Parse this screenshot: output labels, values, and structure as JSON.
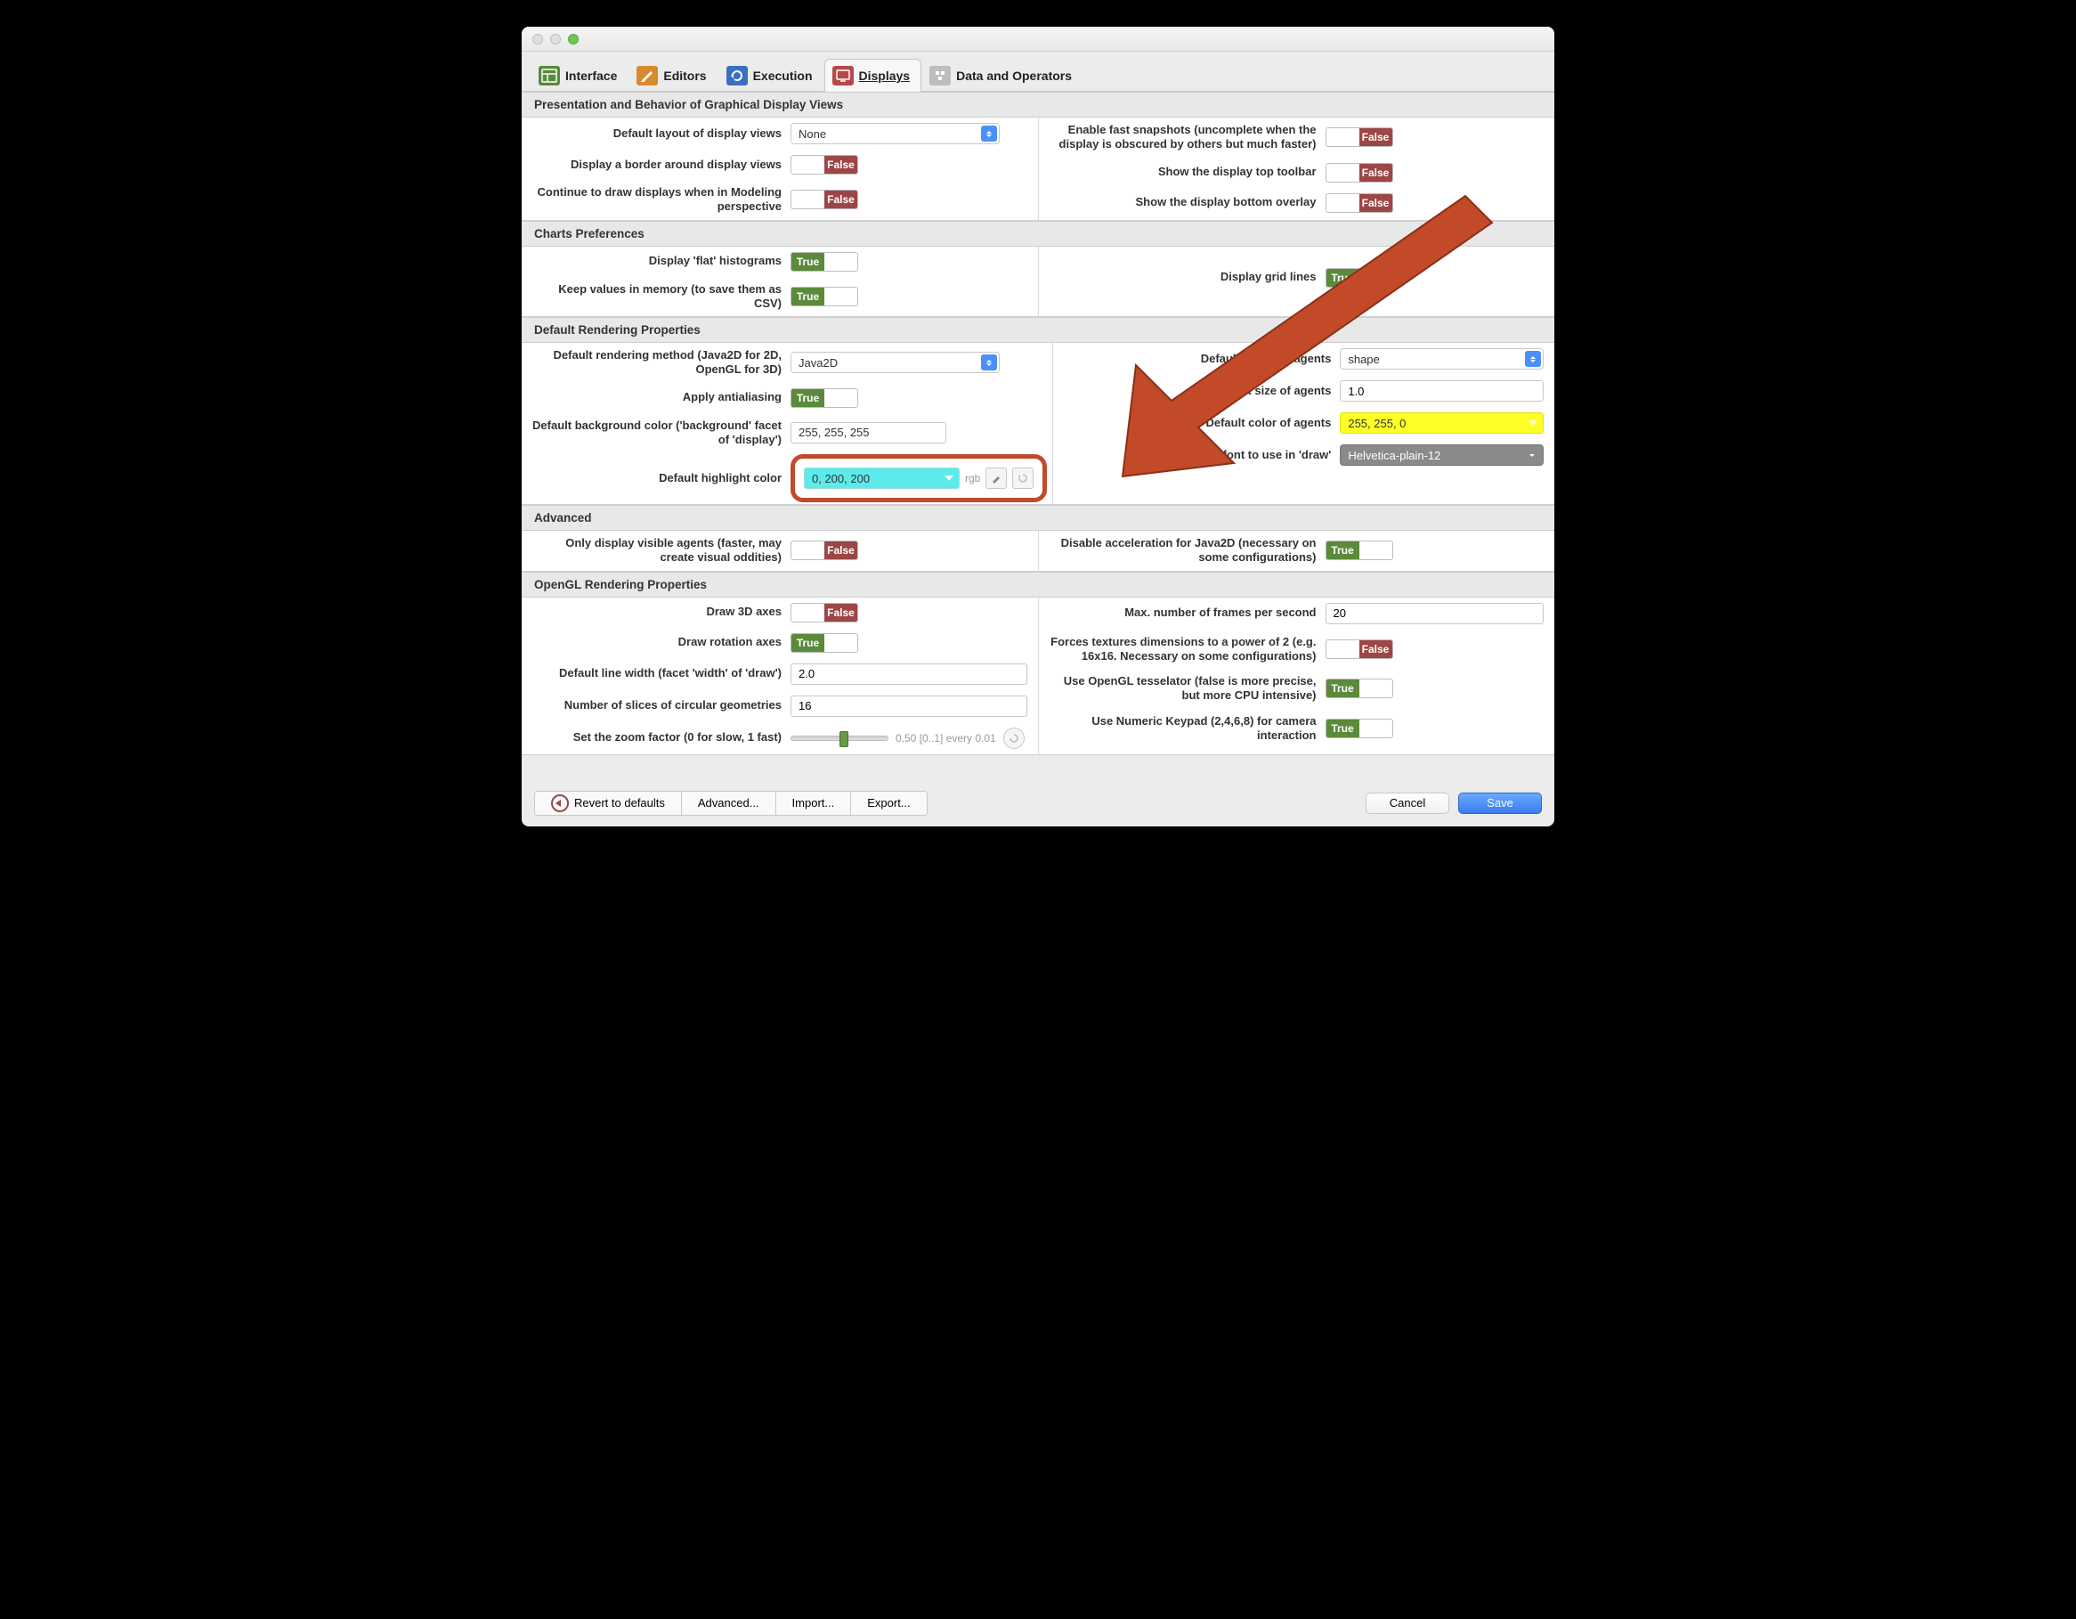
{
  "traffic_colors": {
    "close": "#e0e0e0",
    "min": "#e0e0e0",
    "max": "#6bc950"
  },
  "tabs": [
    {
      "label": "Interface",
      "icon_bg": "#5a8a3a"
    },
    {
      "label": "Editors",
      "icon_bg": "#d88a2e"
    },
    {
      "label": "Execution",
      "icon_bg": "#3a6fbf"
    },
    {
      "label": "Displays",
      "icon_bg": "#b84848"
    },
    {
      "label": "Data and Operators",
      "icon_bg": "#bdbdbd"
    }
  ],
  "sections": {
    "presentation": {
      "title": "Presentation and Behavior of Graphical Display Views",
      "left": {
        "layout_label": "Default layout of display views",
        "layout_value": "None",
        "border_label": "Display a border around display views",
        "border_value": "False",
        "continue_label": "Continue to draw displays when in Modeling perspective",
        "continue_value": "False"
      },
      "right": {
        "snapshots_label": "Enable fast snapshots (uncomplete when the display is obscured by others but much faster)",
        "snapshots_value": "False",
        "toolbar_label": "Show the display top toolbar",
        "toolbar_value": "False",
        "overlay_label": "Show the display bottom overlay",
        "overlay_value": "False"
      }
    },
    "charts": {
      "title": "Charts Preferences",
      "left": {
        "flat_label": "Display 'flat' histograms",
        "flat_value": "True",
        "csv_label": "Keep values in memory (to save them as CSV)",
        "csv_value": "True"
      },
      "right": {
        "grid_label": "Display grid lines",
        "grid_value": "True"
      }
    },
    "rendering": {
      "title": "Default Rendering Properties",
      "left": {
        "method_label": "Default rendering method (Java2D for 2D, OpenGL for 3D)",
        "method_value": "Java2D",
        "aa_label": "Apply antialiasing",
        "aa_value": "True",
        "bg_label": "Default background color ('background' facet of 'display')",
        "bg_value": "255, 255, 255",
        "highlight_label": "Default highlight color",
        "highlight_value": "0, 200, 200",
        "rgb_text": "rgb"
      },
      "right": {
        "shape_label": "Default shape of agents",
        "shape_value": "shape",
        "size_label": "Default size of agents",
        "size_value": "1.0",
        "color_label": "Default color of agents",
        "color_value": "255, 255, 0",
        "font_label": "Default font to use in 'draw'",
        "font_value": "Helvetica-plain-12"
      }
    },
    "advanced": {
      "title": "Advanced",
      "left": {
        "visible_label": "Only display visible agents (faster, may create visual oddities)",
        "visible_value": "False"
      },
      "right": {
        "accel_label": "Disable acceleration for Java2D (necessary on some configurations)",
        "accel_value": "True"
      }
    },
    "opengl": {
      "title": "OpenGL Rendering Properties",
      "left": {
        "axes_label": "Draw 3D axes",
        "axes_value": "False",
        "rot_label": "Draw rotation axes",
        "rot_value": "True",
        "lw_label": "Default line width (facet 'width' of 'draw')",
        "lw_value": "2.0",
        "slices_label": "Number of slices of circular geometries",
        "slices_value": "16",
        "zoom_label": "Set the zoom factor (0 for slow, 1 fast)",
        "zoom_text": "0.50 [0..1] every 0.01",
        "zoom_pos": 0.5
      },
      "right": {
        "fps_label": "Max. number of frames per second",
        "fps_value": "20",
        "tex_label": "Forces textures dimensions to a power of 2 (e.g. 16x16. Necessary on some configurations)",
        "tex_value": "False",
        "tess_label": "Use OpenGL tesselator (false is more precise, but more CPU intensive)",
        "tess_value": "True",
        "keypad_label": "Use Numeric Keypad (2,4,6,8) for camera interaction",
        "keypad_value": "True"
      }
    }
  },
  "footer": {
    "revert": "Revert to defaults",
    "advanced": "Advanced...",
    "import": "Import...",
    "export": "Export...",
    "cancel": "Cancel",
    "save": "Save"
  }
}
